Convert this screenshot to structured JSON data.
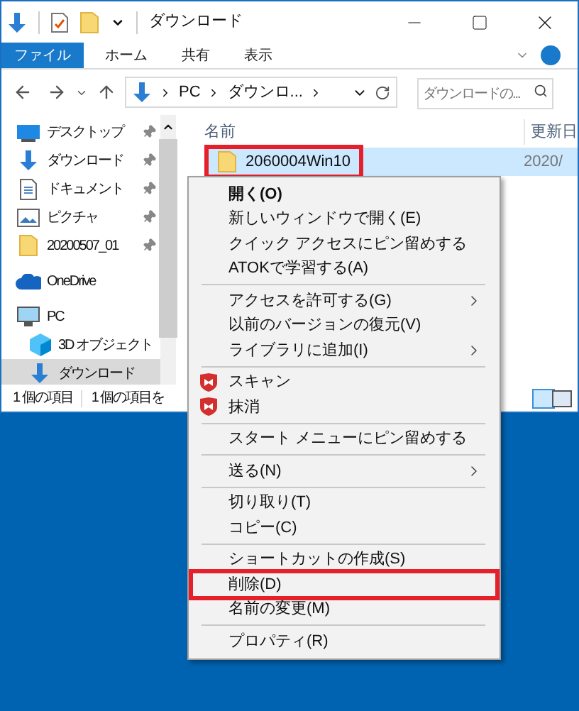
{
  "window": {
    "title": "ダウンロード"
  },
  "ribbon": {
    "tabs": [
      {
        "label": "ファイル",
        "selected": true
      },
      {
        "label": "ホーム",
        "selected": false
      },
      {
        "label": "共有",
        "selected": false
      },
      {
        "label": "表示",
        "selected": false
      }
    ]
  },
  "address": {
    "crumbs": [
      "PC",
      "ダウンロ..."
    ]
  },
  "search": {
    "placeholder": "ダウンロードの..."
  },
  "nav": {
    "items": [
      {
        "label": "デスクトップ",
        "kind": "desktop",
        "pinned": true,
        "selected": false
      },
      {
        "label": "ダウンロード",
        "kind": "download",
        "pinned": true,
        "selected": false
      },
      {
        "label": "ドキュメント",
        "kind": "document",
        "pinned": true,
        "selected": false
      },
      {
        "label": "ピクチャ",
        "kind": "picture",
        "pinned": true,
        "selected": false
      },
      {
        "label": "20200507_01",
        "kind": "folder",
        "pinned": true,
        "selected": false
      },
      {
        "label": "OneDrive",
        "kind": "cloud",
        "pinned": false,
        "selected": false
      },
      {
        "label": "PC",
        "kind": "pc",
        "pinned": false,
        "selected": false,
        "children": [
          {
            "label": "3D オブジェクト",
            "kind": "cube",
            "pinned": false,
            "selected": false
          },
          {
            "label": "ダウンロード",
            "kind": "download",
            "pinned": false,
            "selected": true
          }
        ]
      }
    ]
  },
  "files": {
    "columns": [
      "名前",
      "更新日"
    ],
    "rows": [
      {
        "name": "2060004Win10",
        "date": "2020/",
        "selected": true,
        "highlighted": true
      }
    ]
  },
  "status_bar": {
    "items": [
      "1 個の項目",
      "1 個の項目を"
    ]
  },
  "context_menu": {
    "items": [
      {
        "kind": "item",
        "label": "開く(O)",
        "bold": true,
        "highlighted": false
      },
      {
        "kind": "item",
        "label": "新しいウィンドウで開く(E)",
        "highlighted": false
      },
      {
        "kind": "item",
        "label": "クイック アクセスにピン留めする",
        "highlighted": false
      },
      {
        "kind": "item",
        "label": "ATOKで学習する(A)",
        "highlighted": false
      },
      {
        "kind": "separator"
      },
      {
        "kind": "submenu",
        "label": "アクセスを許可する(G)",
        "highlighted": false
      },
      {
        "kind": "item",
        "label": "以前のバージョンの復元(V)",
        "highlighted": false
      },
      {
        "kind": "submenu",
        "label": "ライブラリに追加(I)",
        "highlighted": false
      },
      {
        "kind": "separator"
      },
      {
        "kind": "shield",
        "label": "スキャン",
        "highlighted": false
      },
      {
        "kind": "shield",
        "label": "抹消",
        "highlighted": false
      },
      {
        "kind": "separator"
      },
      {
        "kind": "item",
        "label": "スタート メニューにピン留めする",
        "highlighted": false
      },
      {
        "kind": "separator"
      },
      {
        "kind": "submenu",
        "label": "送る(N)",
        "highlighted": false
      },
      {
        "kind": "separator"
      },
      {
        "kind": "item",
        "label": "切り取り(T)",
        "highlighted": false
      },
      {
        "kind": "item",
        "label": "コピー(C)",
        "highlighted": false
      },
      {
        "kind": "separator"
      },
      {
        "kind": "item",
        "label": "ショートカットの作成(S)",
        "highlighted": false
      },
      {
        "kind": "item",
        "label": "削除(D)",
        "highlighted": true
      },
      {
        "kind": "item",
        "label": "名前の変更(M)",
        "highlighted": false
      },
      {
        "kind": "separator"
      },
      {
        "kind": "item",
        "label": "プロパティ(R)",
        "highlighted": false
      }
    ]
  }
}
